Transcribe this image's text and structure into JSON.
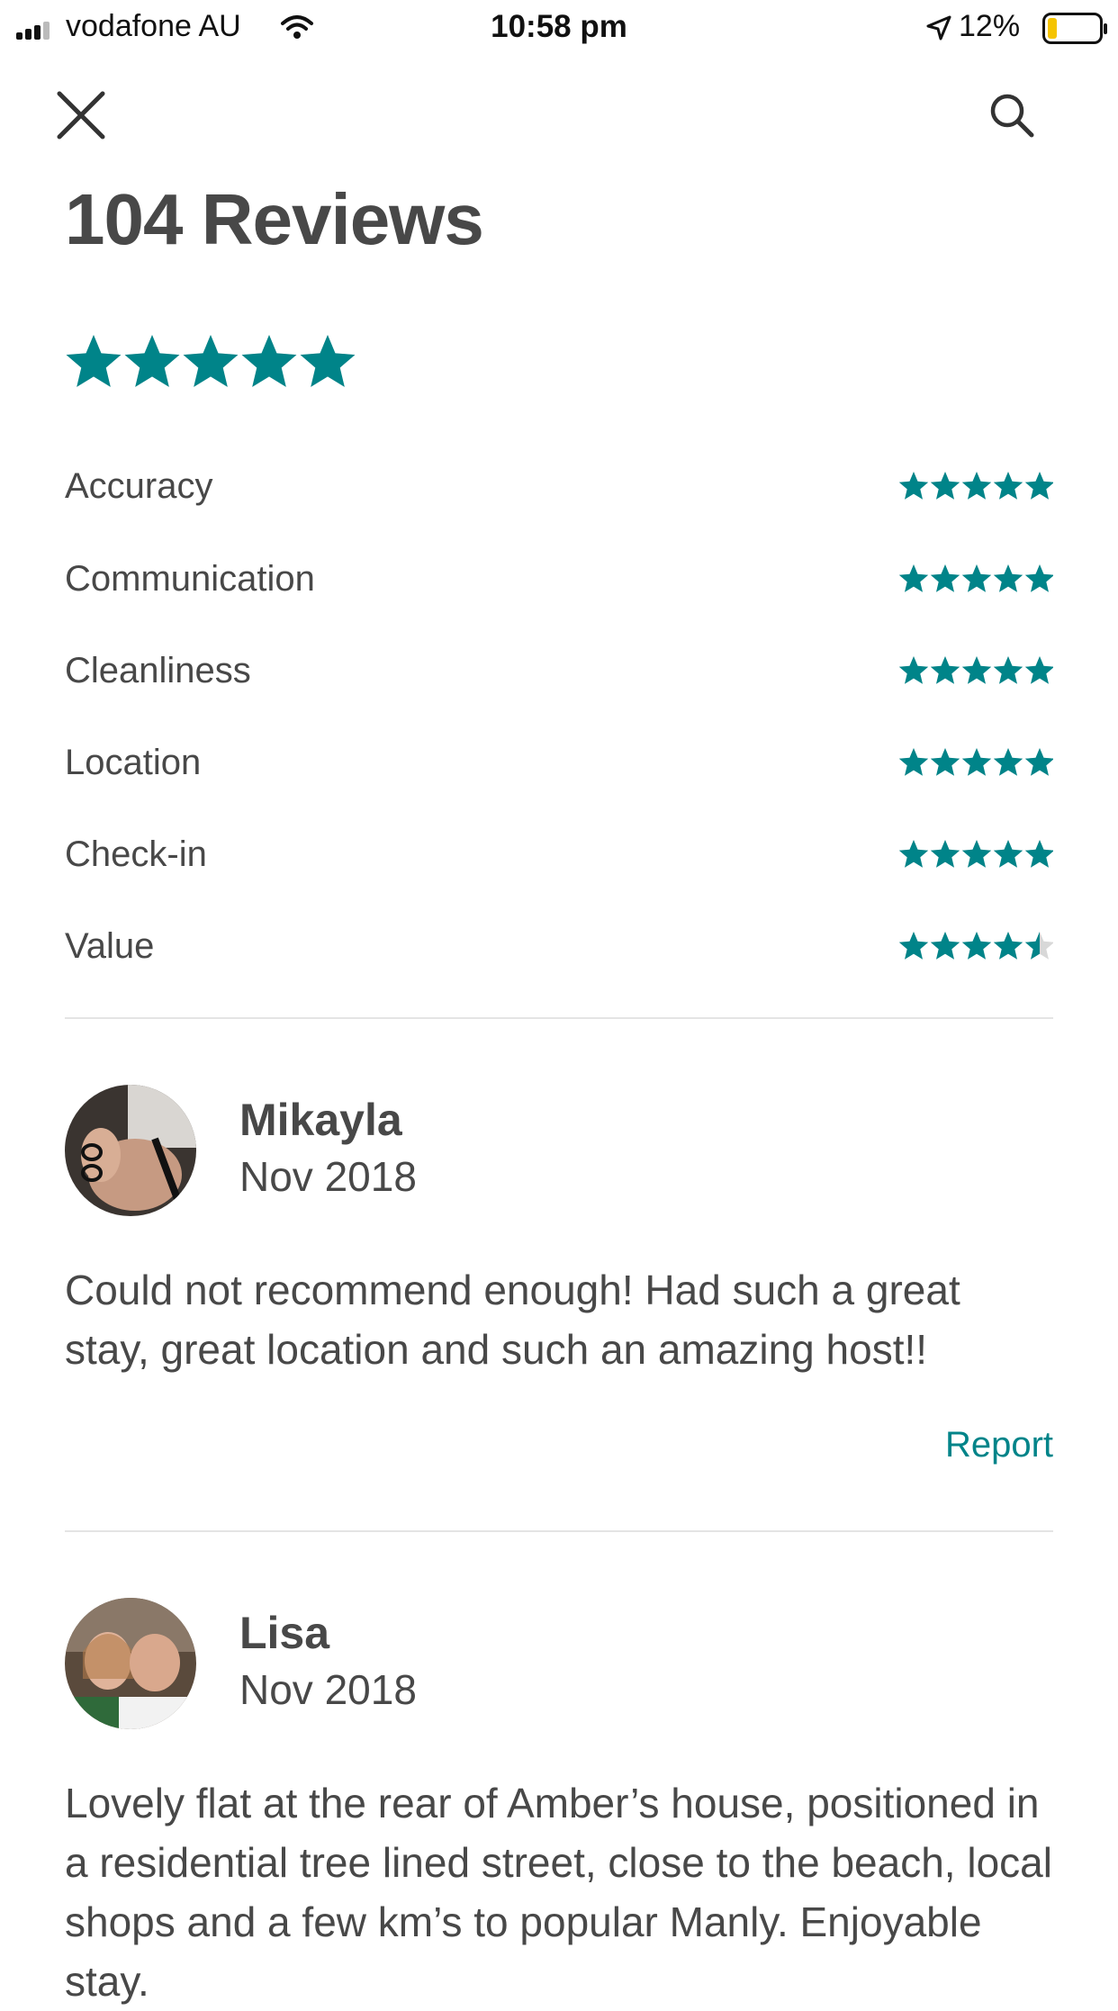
{
  "status_bar": {
    "carrier": "vodafone AU",
    "time": "10:58 pm",
    "battery": "12%"
  },
  "header": {
    "title": "104 Reviews",
    "close_icon": "close-icon",
    "search_icon": "search-icon"
  },
  "overall_rating": {
    "stars": 5,
    "max": 5,
    "icon": "star-icon"
  },
  "ratings": [
    {
      "label": "Accuracy",
      "stars": 5
    },
    {
      "label": "Communication",
      "stars": 5
    },
    {
      "label": "Cleanliness",
      "stars": 5
    },
    {
      "label": "Location",
      "stars": 5
    },
    {
      "label": "Check-in",
      "stars": 5
    },
    {
      "label": "Value",
      "stars": 4.5
    }
  ],
  "reviews": [
    {
      "name": "Mikayla",
      "date": "Nov 2018",
      "text": "Could not recommend enough! Had such a great stay, great location and such an amazing host!!",
      "action": "Report"
    },
    {
      "name": "Lisa",
      "date": "Nov 2018",
      "text": "Lovely flat at the rear of Amber’s house, positioned in a residential tree lined street, close to the beach, local shops and a few km’s to popular Manly. Enjoyable stay."
    }
  ],
  "colors": {
    "accent": "#008489",
    "text": "#484848",
    "divider": "#e4e4e4",
    "battery_low": "#f5c400"
  }
}
